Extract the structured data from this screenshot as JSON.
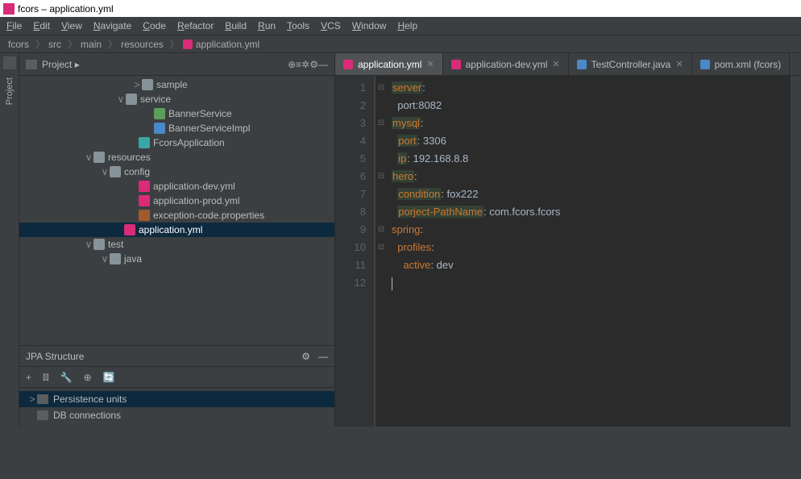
{
  "title": "fcors – application.yml",
  "menu": [
    "File",
    "Edit",
    "View",
    "Navigate",
    "Code",
    "Refactor",
    "Build",
    "Run",
    "Tools",
    "VCS",
    "Window",
    "Help"
  ],
  "breadcrumbs": [
    "fcors",
    "src",
    "main",
    "resources",
    "application.yml"
  ],
  "projectHeader": {
    "label": "Project",
    "tools": [
      "⊕",
      "≡",
      "✲",
      "⚙",
      "—"
    ]
  },
  "tree": [
    {
      "indent": 140,
      "arrow": ">",
      "icon": "ico-folder",
      "label": "sample"
    },
    {
      "indent": 120,
      "arrow": "∨",
      "icon": "ico-folder",
      "label": "service"
    },
    {
      "indent": 155,
      "arrow": "",
      "icon": "ico-interface",
      "label": "BannerService"
    },
    {
      "indent": 155,
      "arrow": "",
      "icon": "ico-class",
      "label": "BannerServiceImpl"
    },
    {
      "indent": 136,
      "arrow": "",
      "icon": "ico-teal",
      "label": "FcorsApplication"
    },
    {
      "indent": 80,
      "arrow": "∨",
      "icon": "ico-folder",
      "label": "resources"
    },
    {
      "indent": 100,
      "arrow": "∨",
      "icon": "ico-folder",
      "label": "config"
    },
    {
      "indent": 136,
      "arrow": "",
      "icon": "ico-yml",
      "label": "application-dev.yml"
    },
    {
      "indent": 136,
      "arrow": "",
      "icon": "ico-yml",
      "label": "application-prod.yml"
    },
    {
      "indent": 136,
      "arrow": "",
      "icon": "ico-prop",
      "label": "exception-code.properties"
    },
    {
      "indent": 118,
      "arrow": "",
      "icon": "ico-yml",
      "label": "application.yml",
      "sel": true
    },
    {
      "indent": 80,
      "arrow": "∨",
      "icon": "ico-folder",
      "label": "test"
    },
    {
      "indent": 100,
      "arrow": "∨",
      "icon": "ico-folder",
      "label": "java"
    }
  ],
  "jpa": {
    "title": "JPA Structure",
    "tools": [
      "+",
      "⫾⫾",
      "🔧",
      "⊕",
      "🔄"
    ],
    "rows": [
      {
        "label": "Persistence units",
        "sel": true,
        "arrow": ">"
      },
      {
        "label": "DB connections",
        "sel": false,
        "arrow": ""
      }
    ]
  },
  "tabs": [
    {
      "label": "application.yml",
      "icon": "fi-yml",
      "active": true,
      "close": true
    },
    {
      "label": "application-dev.yml",
      "icon": "fi-yml",
      "active": false,
      "close": true
    },
    {
      "label": "TestController.java",
      "icon": "fi-java",
      "active": false,
      "close": true
    },
    {
      "label": "pom.xml (fcors)",
      "icon": "fi-pom",
      "active": false,
      "close": false
    }
  ],
  "code": {
    "lines": [
      1,
      2,
      3,
      4,
      5,
      6,
      7,
      8,
      9,
      10,
      11,
      12
    ],
    "content": [
      {
        "t": "kw",
        "k": "server",
        "after": ":"
      },
      {
        "pad": 2,
        "t": "plain",
        "k": "port:8082"
      },
      {
        "t": "kw",
        "k": "mysql",
        "after": ":"
      },
      {
        "pad": 2,
        "t": "kw",
        "k": "port",
        "after": ": ",
        "v": "3306"
      },
      {
        "pad": 2,
        "t": "kw",
        "k": "ip",
        "after": ": ",
        "v": "192.168.8.8"
      },
      {
        "t": "kw",
        "k": "hero",
        "after": ":"
      },
      {
        "pad": 2,
        "t": "kw",
        "k": "condition",
        "after": ": ",
        "v": "fox222"
      },
      {
        "pad": 2,
        "t": "kw",
        "k": "porject-PathName",
        "after": ": ",
        "v": "com.fcors.fcors"
      },
      {
        "t": "key",
        "k": "spring",
        "after": ":"
      },
      {
        "pad": 2,
        "t": "key",
        "k": "profiles",
        "after": ":"
      },
      {
        "pad": 4,
        "t": "key",
        "k": "active",
        "after": ": ",
        "v": "dev"
      },
      {
        "caret": true
      }
    ]
  },
  "sidebarStrip": {
    "label": "Project"
  }
}
